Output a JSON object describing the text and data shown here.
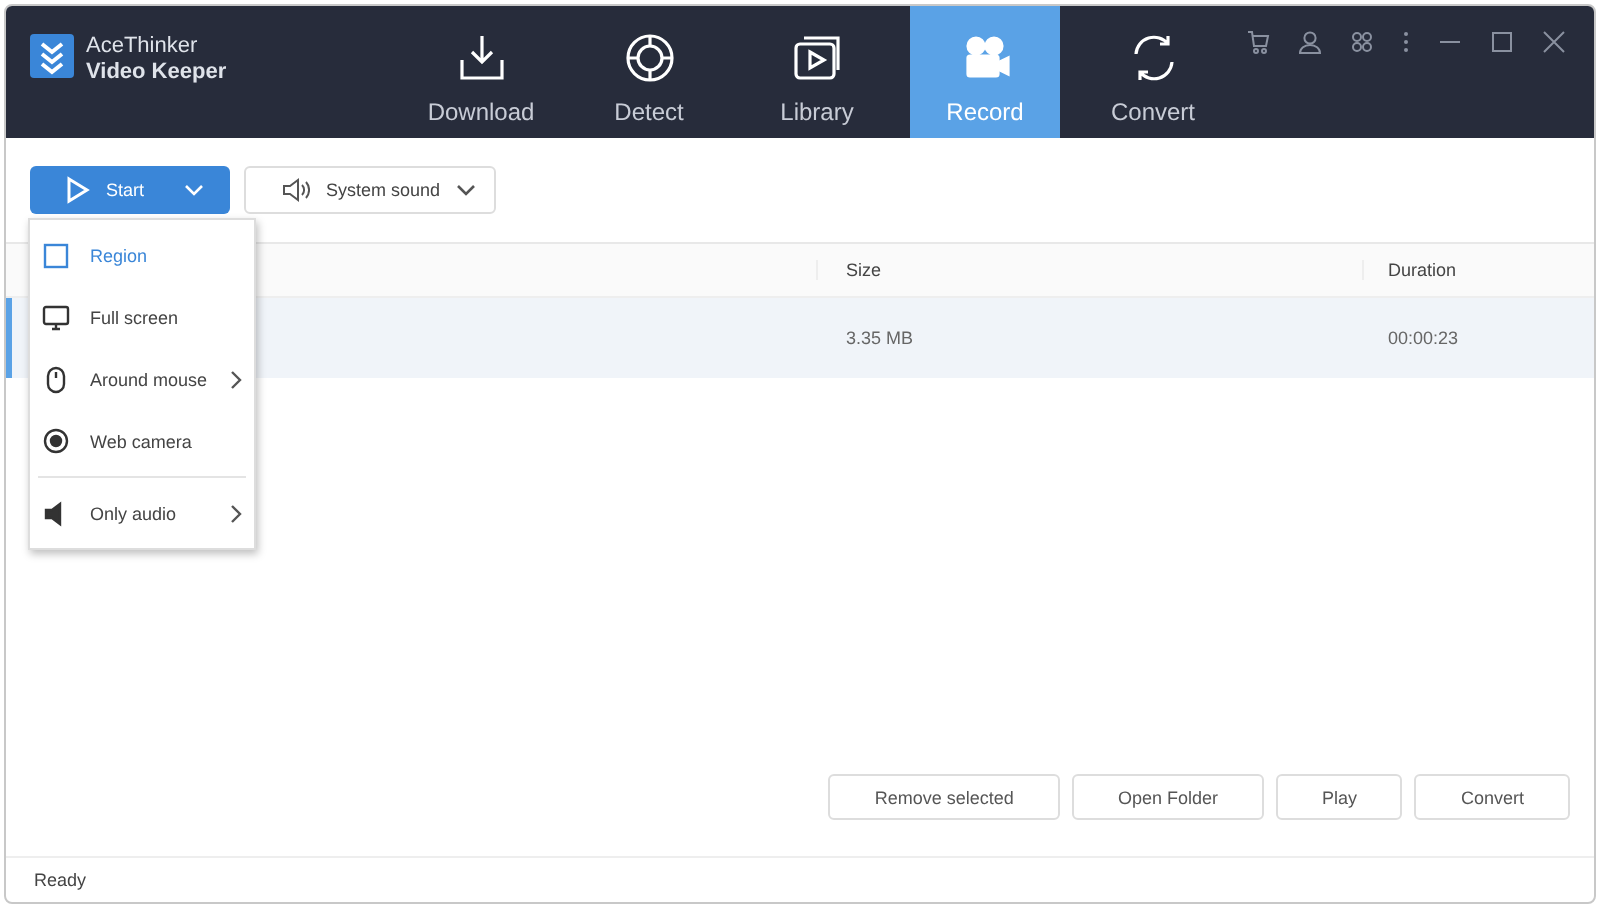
{
  "app": {
    "name": "AceThinker",
    "product": "Video Keeper"
  },
  "tabs": [
    {
      "label": "Download",
      "kind": "download",
      "selected": false
    },
    {
      "label": "Detect",
      "kind": "detect",
      "selected": false
    },
    {
      "label": "Library",
      "kind": "library",
      "selected": false
    },
    {
      "label": "Record",
      "kind": "record",
      "selected": true
    },
    {
      "label": "Convert",
      "kind": "convert",
      "selected": false
    }
  ],
  "toolbar": {
    "start": "Start",
    "audio": "System sound"
  },
  "menu": [
    {
      "label": "Region",
      "kind": "region",
      "selected": true,
      "submenu": false
    },
    {
      "label": "Full screen",
      "kind": "screen",
      "selected": false,
      "submenu": false
    },
    {
      "label": "Around mouse",
      "kind": "mouse",
      "selected": false,
      "submenu": true
    },
    {
      "label": "Web camera",
      "kind": "camera",
      "selected": false,
      "submenu": false
    },
    {
      "label": "Only audio",
      "kind": "audio",
      "selected": false,
      "submenu": true
    }
  ],
  "table": {
    "columns": [
      "Size",
      "Duration"
    ],
    "rows": [
      {
        "cells": [
          "3.35 MB",
          "00:00:23"
        ],
        "selected": true
      }
    ]
  },
  "buttons": [
    "Remove selected",
    "Open Folder",
    "Play",
    "Convert"
  ],
  "status_bar": "Ready"
}
